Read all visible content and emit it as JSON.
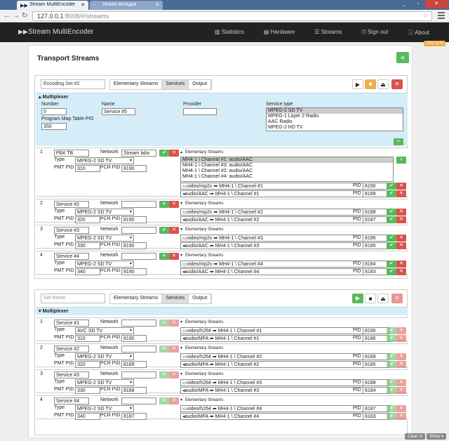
{
  "browser": {
    "tabs": [
      {
        "label": "Stream MultiEncoder"
      },
      {
        "label": "Новая вкладка"
      }
    ],
    "url_host": "127.0.0.1",
    "url_rest": ":8008/#/streams"
  },
  "navbar": {
    "brand": "Stream MultiEncoder",
    "menu": [
      "Statistics",
      "Hardware",
      "Streams",
      "Sign out",
      "About"
    ]
  },
  "version_badge": "CPU: 15 %",
  "page_title": "Transport Streams",
  "tabs": [
    "Elementary Streams",
    "Services",
    "Output"
  ],
  "set1": {
    "name": "Encoding Set #2",
    "multiplexer": {
      "header": "Multiplexer",
      "number_label": "Number",
      "number": "5",
      "name_label": "Name",
      "name": "Service #5",
      "provider_label": "Provider",
      "provider": "",
      "pmt_label": "Program Map Table PID",
      "pmt": "350",
      "service_type_label": "Service type",
      "service_types": [
        "MPEG-2 SD TV",
        "MPEG-1 Layer 2 Radio",
        "AAC Radio",
        "MPEG-2 HD TV"
      ]
    },
    "services": [
      {
        "num": "1",
        "name": "РБК ТВ",
        "network": "Stream labs",
        "type": "MPEG-2 SD TV",
        "pmt": "310",
        "pcr": "8190",
        "es_list": [
          "МН4-1 \\ Channel #1: audio/AAC",
          "МН4-1 \\ Channel #3: audio/AAC",
          "МН4-1 \\ Channel #2: audio/AAC",
          "МН4-1 \\ Channel #4: audio/AAC"
        ],
        "es": [
          {
            "src": "video/mp2v",
            "dst": "МН4-1 \\ Channel #1",
            "pid": "8190"
          },
          {
            "src": "audio/AAC",
            "dst": "МН4-1 \\ Channel #1",
            "pid": "8189"
          }
        ]
      },
      {
        "num": "2",
        "name": "Service #2",
        "network": "",
        "type": "MPEG-2 SD TV",
        "pmt": "320",
        "pcr": "8190",
        "es": [
          {
            "src": "video/mp2v",
            "dst": "МН4-1 \\ Channel #2",
            "pid": "8188"
          },
          {
            "src": "audio/AAC",
            "dst": "МН4-1 \\ Channel #2",
            "pid": "8187"
          }
        ]
      },
      {
        "num": "3",
        "name": "Service #3",
        "network": "",
        "type": "MPEG-2 SD TV",
        "pmt": "330",
        "pcr": "8190",
        "es": [
          {
            "src": "video/mp2v",
            "dst": "МН4-1 \\ Channel #3",
            "pid": "8186"
          },
          {
            "src": "audio/AAC",
            "dst": "МН4-1 \\ Channel #3",
            "pid": "8185"
          }
        ]
      },
      {
        "num": "4",
        "name": "Service #4",
        "network": "",
        "type": "MPEG-2 SD TV",
        "pmt": "340",
        "pcr": "8190",
        "es": [
          {
            "src": "video/mp2v",
            "dst": "МН4-1 \\ Channel #4",
            "pid": "8184"
          },
          {
            "src": "audio/AAC",
            "dst": "МН4-1 \\ Channel #4",
            "pid": "8183"
          }
        ]
      }
    ]
  },
  "set2": {
    "name_placeholder": "Set Name",
    "multiplexer_header": "Multiplexer",
    "services": [
      {
        "num": "1",
        "name": "Service #1",
        "network": "",
        "type": "AVC SD TV",
        "pmt": "310",
        "pcr": "8190",
        "es": [
          {
            "src": "video/h264",
            "dst": "МН4-1 \\ Channel #1",
            "pid": "8190"
          },
          {
            "src": "audio/MPA",
            "dst": "МН4-1 \\ Channel #1",
            "pid": "8186"
          }
        ]
      },
      {
        "num": "2",
        "name": "Service #2",
        "network": "",
        "type": "MPEG-2 SD TV",
        "pmt": "320",
        "pcr": "8189",
        "es": [
          {
            "src": "video/h264",
            "dst": "МН4-1 \\ Channel #2",
            "pid": "8189"
          },
          {
            "src": "audio/MPA",
            "dst": "МН4-1 \\ Channel #2",
            "pid": "8185"
          }
        ]
      },
      {
        "num": "3",
        "name": "Service #3",
        "network": "",
        "type": "MPEG-2 SD TV",
        "pmt": "330",
        "pcr": "8188",
        "es": [
          {
            "src": "video/h264",
            "dst": "МН4-1 \\ Channel #3",
            "pid": "8188"
          },
          {
            "src": "audio/MPA",
            "dst": "МН4-1 \\ Channel #3",
            "pid": "8184"
          }
        ]
      },
      {
        "num": "4",
        "name": "Service #4",
        "network": "",
        "type": "MPEG-2 SD TV",
        "pmt": "340",
        "pcr": "8187",
        "es": [
          {
            "src": "video/h264",
            "dst": "МН4-1 \\ Channel #4",
            "pid": "8187"
          },
          {
            "src": "audio/MPA",
            "dst": "МН4-1 \\ Channel #4",
            "pid": "8183"
          }
        ]
      }
    ]
  },
  "labels": {
    "network": "Network",
    "type": "Type",
    "pmt_pid": "PMT PID",
    "pcr_pid": "PCR PID",
    "es": "Elementary Streams",
    "pid": "PID"
  },
  "footer": {
    "clear": "Clear ✕",
    "show": "Show ▾"
  }
}
